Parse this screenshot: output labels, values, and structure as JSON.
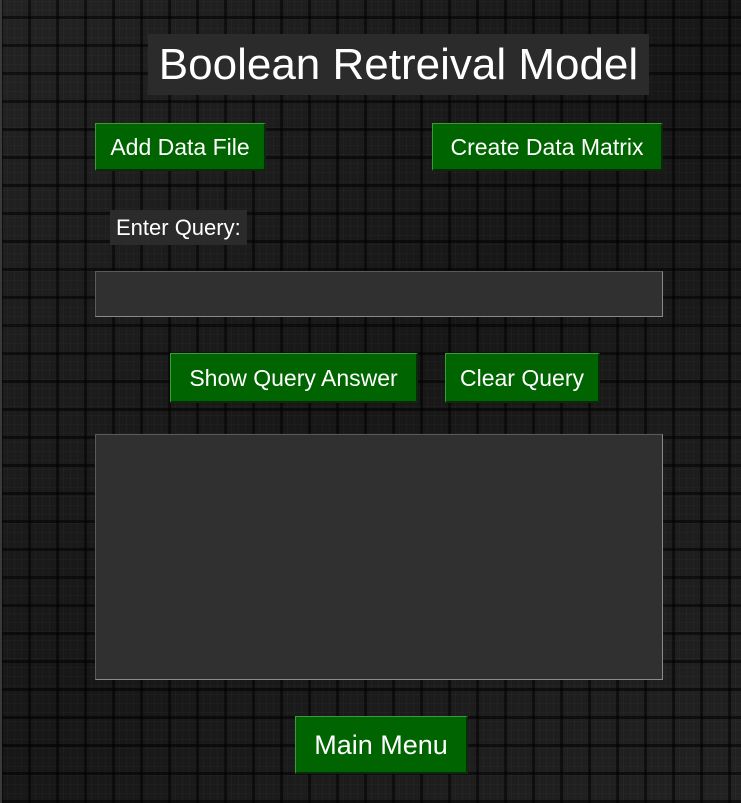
{
  "window": {
    "title": "Boolean Retreival Model"
  },
  "toolbar": {
    "add_data_file_label": "Add Data File",
    "create_data_matrix_label": "Create Data Matrix"
  },
  "query": {
    "label": "Enter Query:",
    "value": "",
    "placeholder": ""
  },
  "actions": {
    "show_query_answer_label": "Show Query Answer",
    "clear_query_label": "Clear Query"
  },
  "answer": {
    "value": ""
  },
  "footer": {
    "main_menu_label": "Main Menu"
  },
  "colors": {
    "button_bg": "#006400",
    "field_bg": "#303030",
    "text": "#ffffff"
  }
}
